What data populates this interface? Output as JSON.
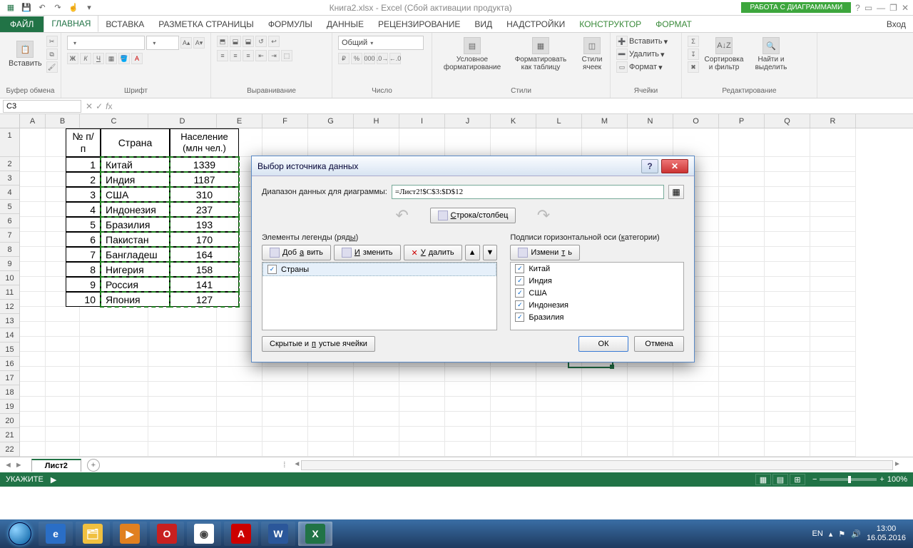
{
  "titlebar": {
    "title": "Книга2.xlsx - Excel (Сбой активации продукта)",
    "chart_tools": "РАБОТА С ДИАГРАММАМИ"
  },
  "ribbon_tabs": {
    "file": "ФАЙЛ",
    "items": [
      "ГЛАВНАЯ",
      "ВСТАВКА",
      "РАЗМЕТКА СТРАНИЦЫ",
      "ФОРМУЛЫ",
      "ДАННЫЕ",
      "РЕЦЕНЗИРОВАНИЕ",
      "ВИД",
      "НАДСТРОЙКИ",
      "КОНСТРУКТОР",
      "ФОРМАТ"
    ],
    "right": "Вход"
  },
  "ribbon": {
    "clipboard": {
      "paste": "Вставить",
      "label": "Буфер обмена"
    },
    "font": {
      "bold": "Ж",
      "italic": "К",
      "underline": "Ч",
      "label": "Шрифт"
    },
    "align": {
      "label": "Выравнивание"
    },
    "number": {
      "format": "Общий",
      "label": "Число"
    },
    "styles": {
      "cond": "Условное форматирование",
      "table": "Форматировать как таблицу",
      "cell": "Стили ячеек",
      "label": "Стили"
    },
    "cells": {
      "insert": "Вставить",
      "delete": "Удалить",
      "format": "Формат",
      "label": "Ячейки"
    },
    "editing": {
      "sort": "Сортировка и фильтр",
      "find": "Найти и выделить",
      "label": "Редактирование"
    }
  },
  "formula_bar": {
    "name_box": "C3",
    "formula": ""
  },
  "columns": [
    "A",
    "B",
    "C",
    "D",
    "E",
    "F",
    "G",
    "H",
    "I",
    "J",
    "K",
    "L",
    "M",
    "N",
    "O",
    "P",
    "Q",
    "R"
  ],
  "rows_count": 22,
  "table": {
    "headers": [
      "№ п/п",
      "Страна",
      "Население (млн чел.)"
    ],
    "rows": [
      {
        "n": "1",
        "country": "Китай",
        "pop": "1339"
      },
      {
        "n": "2",
        "country": "Индия",
        "pop": "1187"
      },
      {
        "n": "3",
        "country": "США",
        "pop": "310"
      },
      {
        "n": "4",
        "country": "Индонезия",
        "pop": "237"
      },
      {
        "n": "5",
        "country": "Бразилия",
        "pop": "193"
      },
      {
        "n": "6",
        "country": "Пакистан",
        "pop": "170"
      },
      {
        "n": "7",
        "country": "Бангладеш",
        "pop": "164"
      },
      {
        "n": "8",
        "country": "Нигерия",
        "pop": "158"
      },
      {
        "n": "9",
        "country": "Россия",
        "pop": "141"
      },
      {
        "n": "10",
        "country": "Япония",
        "pop": "127"
      }
    ]
  },
  "dialog": {
    "title": "Выбор источника данных",
    "range_label": "Диапазон данных для диаграммы:",
    "range_value": "=Лист2!$C$3:$D$12",
    "switch": "Строка/столбец",
    "legend_title": "Элементы легенды (ряды)",
    "cat_title": "Подписи горизонтальной оси (категории)",
    "add": "Добавить",
    "edit": "Изменить",
    "delete": "Удалить",
    "edit2": "Изменить",
    "series": [
      "Страны"
    ],
    "categories": [
      "Китай",
      "Индия",
      "США",
      "Индонезия",
      "Бразилия"
    ],
    "hidden": "Скрытые и пустые ячейки",
    "ok": "ОК",
    "cancel": "Отмена"
  },
  "sheet_tabs": {
    "active": "Лист2"
  },
  "statusbar": {
    "mode": "УКАЖИТЕ",
    "zoom": "100%"
  },
  "taskbar": {
    "lang": "EN",
    "time": "13:00",
    "date": "16.05.2016"
  }
}
